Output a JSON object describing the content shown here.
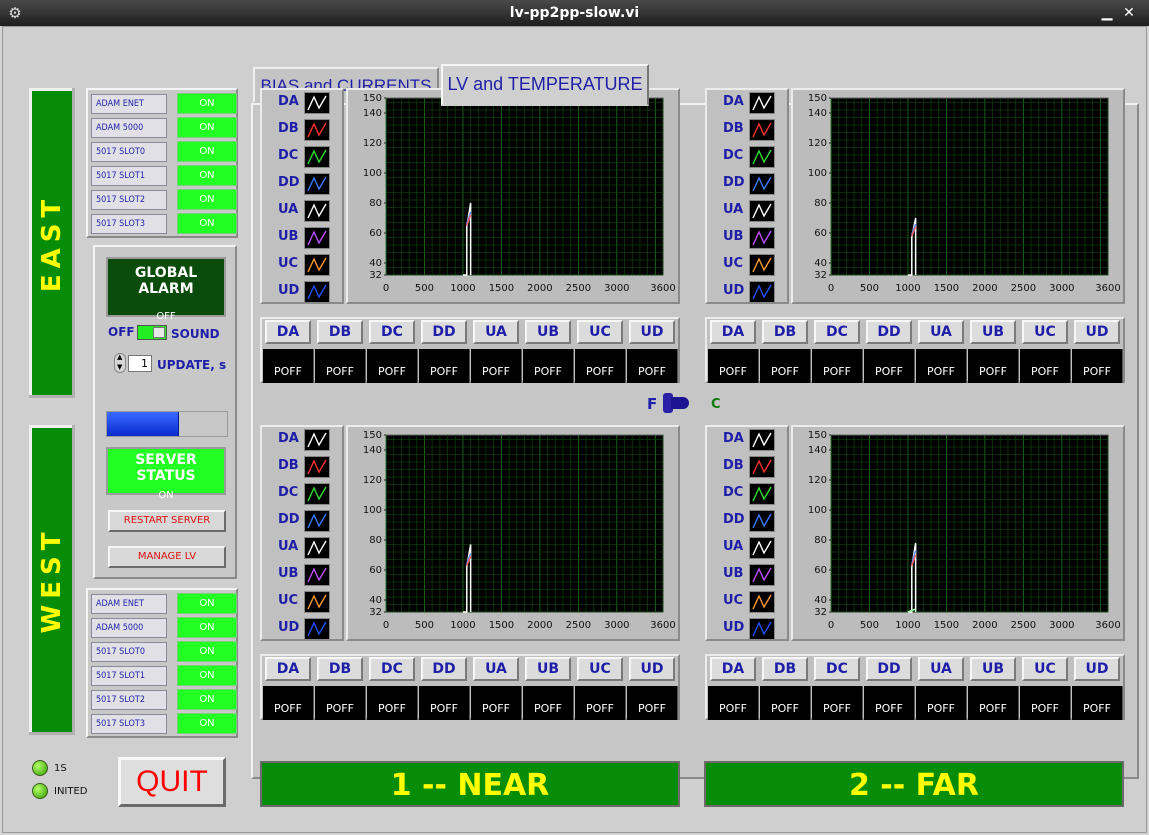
{
  "window": {
    "title": "lv-pp2pp-slow.vi",
    "minimize_glyph": "▁",
    "close_glyph": "✕",
    "app_icon_glyph": "⚙"
  },
  "sides": {
    "east": "EAST",
    "west": "WEST"
  },
  "east_status": [
    {
      "label": "ADAM ENET",
      "value": "ON"
    },
    {
      "label": "ADAM 5000",
      "value": "ON"
    },
    {
      "label": "5017 SLOT0",
      "value": "ON"
    },
    {
      "label": "5017 SLOT1",
      "value": "ON"
    },
    {
      "label": "5017 SLOT2",
      "value": "ON"
    },
    {
      "label": "5017 SLOT3",
      "value": "ON"
    }
  ],
  "west_status": [
    {
      "label": "ADAM ENET",
      "value": "ON"
    },
    {
      "label": "ADAM 5000",
      "value": "ON"
    },
    {
      "label": "5017 SLOT0",
      "value": "ON"
    },
    {
      "label": "5017 SLOT1",
      "value": "ON"
    },
    {
      "label": "5017 SLOT2",
      "value": "ON"
    },
    {
      "label": "5017 SLOT3",
      "value": "ON"
    }
  ],
  "control": {
    "global_alarm_title": "GLOBAL ALARM",
    "global_alarm_value": "OFF",
    "sound_off_label": "OFF",
    "sound_label": "SOUND",
    "update_value": "1",
    "update_label": "UPDATE, s",
    "progress_fraction": 0.6,
    "server_status_title": "SERVER STATUS",
    "server_status_value": "ON",
    "restart_label": "RESTART SERVER",
    "manage_label": "MANAGE LV"
  },
  "tabs": [
    {
      "label": "BIAS and CURRENTS",
      "active": false
    },
    {
      "label": "LV and TEMPERATURE",
      "active": true
    }
  ],
  "channels": [
    "DA",
    "DB",
    "DC",
    "DD",
    "UA",
    "UB",
    "UC",
    "UD"
  ],
  "channel_colors": [
    "#ffffff",
    "#ff3030",
    "#30e030",
    "#3a7aff",
    "#ffffff",
    "#c050ff",
    "#ff9a30",
    "#2050ff"
  ],
  "cell_values": [
    "POFF",
    "POFF",
    "POFF",
    "POFF",
    "POFF",
    "POFF",
    "POFF",
    "POFF"
  ],
  "switch": {
    "left_label": "F",
    "right_label": "C"
  },
  "bottom": {
    "left_label": "1 -- NEAR",
    "right_label": "2 -- FAR"
  },
  "quit_label": "QUIT",
  "leds": [
    {
      "label": "1S"
    },
    {
      "label": "INITED"
    }
  ],
  "chart_data": [
    {
      "type": "line",
      "xlim": [
        0,
        3600
      ],
      "ylim": [
        32,
        150
      ],
      "x_ticks": [
        0,
        500,
        1000,
        1500,
        2000,
        2500,
        3000,
        3600
      ],
      "y_ticks": [
        32,
        40,
        60,
        80,
        100,
        120,
        140,
        150
      ],
      "grid": true,
      "series": [
        {
          "x": [
            1000,
            1050,
            1050,
            1100,
            1100
          ],
          "y": [
            32,
            32,
            64,
            80,
            32
          ]
        },
        {
          "x": [
            1050,
            1100
          ],
          "y": [
            66,
            74
          ]
        },
        {
          "x": [
            1050,
            1100
          ],
          "y": [
            65,
            72
          ]
        }
      ]
    },
    {
      "type": "line",
      "xlim": [
        0,
        3600
      ],
      "ylim": [
        32,
        150
      ],
      "x_ticks": [
        0,
        500,
        1000,
        1500,
        2000,
        2500,
        3000,
        3600
      ],
      "y_ticks": [
        32,
        40,
        60,
        80,
        100,
        120,
        140,
        150
      ],
      "grid": true,
      "series": [
        {
          "x": [
            1000,
            1050,
            1050,
            1100,
            1100
          ],
          "y": [
            32,
            32,
            57,
            70,
            32
          ]
        },
        {
          "x": [
            1050,
            1100
          ],
          "y": [
            59,
            66
          ]
        },
        {
          "x": [
            1050,
            1100
          ],
          "y": [
            58,
            64
          ]
        }
      ]
    },
    {
      "type": "line",
      "xlim": [
        0,
        3600
      ],
      "ylim": [
        32,
        150
      ],
      "x_ticks": [
        0,
        500,
        1000,
        1500,
        2000,
        2500,
        3000,
        3600
      ],
      "y_ticks": [
        32,
        40,
        60,
        80,
        100,
        120,
        140,
        150
      ],
      "grid": true,
      "series": [
        {
          "x": [
            1000,
            1050,
            1050,
            1100,
            1100
          ],
          "y": [
            32,
            32,
            62,
            77,
            32
          ]
        },
        {
          "x": [
            1050,
            1100
          ],
          "y": [
            64,
            71
          ]
        },
        {
          "x": [
            1050,
            1100
          ],
          "y": [
            63,
            69
          ]
        }
      ]
    },
    {
      "type": "line",
      "xlim": [
        0,
        3600
      ],
      "ylim": [
        32,
        150
      ],
      "x_ticks": [
        0,
        500,
        1000,
        1500,
        2000,
        2500,
        3000,
        3600
      ],
      "y_ticks": [
        32,
        40,
        60,
        80,
        100,
        120,
        140,
        150
      ],
      "grid": true,
      "series": [
        {
          "x": [
            1000,
            1050,
            1050,
            1100,
            1100
          ],
          "y": [
            32,
            32,
            62,
            78,
            32
          ]
        },
        {
          "x": [
            1050,
            1100
          ],
          "y": [
            64,
            73
          ]
        },
        {
          "x": [
            1050,
            1100
          ],
          "y": [
            63,
            70
          ]
        },
        {
          "x": [
            1000,
            1100
          ],
          "y": [
            32,
            34
          ]
        }
      ]
    }
  ]
}
